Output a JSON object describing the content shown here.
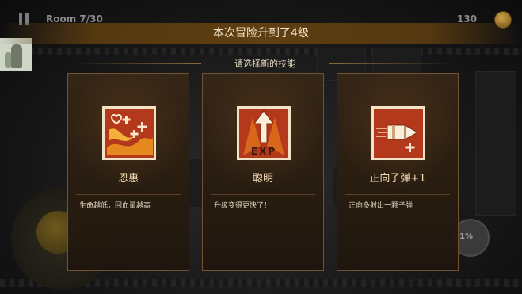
{
  "hud": {
    "room": "Room 7/30",
    "coins": "130",
    "skill_percent": "1%"
  },
  "levelup": {
    "title": "本次冒险升到了4级",
    "subtitle": "请选择新的技能"
  },
  "skills": [
    {
      "name": "恩惠",
      "desc": "生命越低，回血量越高",
      "icon": "heart-regen-icon"
    },
    {
      "name": "聪明",
      "desc": "升级变得更快了！",
      "icon": "exp-arrow-icon",
      "icon_text": "EXP"
    },
    {
      "name": "正向子弹+1",
      "desc": "正向多射出一颗子弹",
      "icon": "bullet-plus-icon"
    }
  ],
  "colors": {
    "title_bar": "#60400f",
    "card_border": "#6e5334",
    "icon_bg": "#b3381c",
    "icon_glow": "#f1a021"
  }
}
